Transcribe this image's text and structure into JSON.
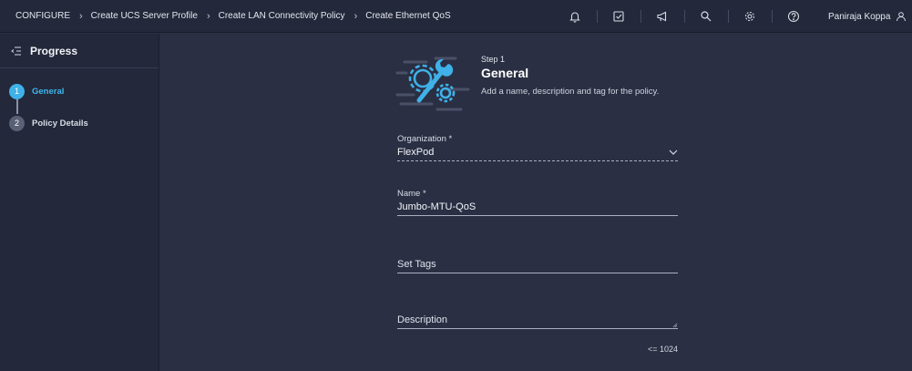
{
  "breadcrumb": {
    "items": [
      "CONFIGURE",
      "Create UCS Server Profile",
      "Create LAN Connectivity Policy",
      "Create Ethernet QoS"
    ]
  },
  "topbar": {
    "icons": [
      "bell-icon",
      "checklist-icon",
      "megaphone-icon",
      "search-icon",
      "gear-icon",
      "help-icon"
    ],
    "user_name": "Paniraja Koppa"
  },
  "sidebar": {
    "title": "Progress",
    "steps": [
      {
        "number": "1",
        "label": "General",
        "active": true
      },
      {
        "number": "2",
        "label": "Policy Details",
        "active": false
      }
    ]
  },
  "header": {
    "step": "Step 1",
    "title": "General",
    "description": "Add a name, description and tag for the policy."
  },
  "form": {
    "organization": {
      "label": "Organization *",
      "value": "FlexPod"
    },
    "name": {
      "label": "Name *",
      "value": "Jumbo-MTU-QoS"
    },
    "tags": {
      "placeholder": "Set Tags"
    },
    "description": {
      "placeholder": "Description",
      "counter": "<= 1024"
    }
  },
  "colors": {
    "accent": "#3fb1e8",
    "background": "#2a2f43",
    "sidebar": "#23283a"
  }
}
